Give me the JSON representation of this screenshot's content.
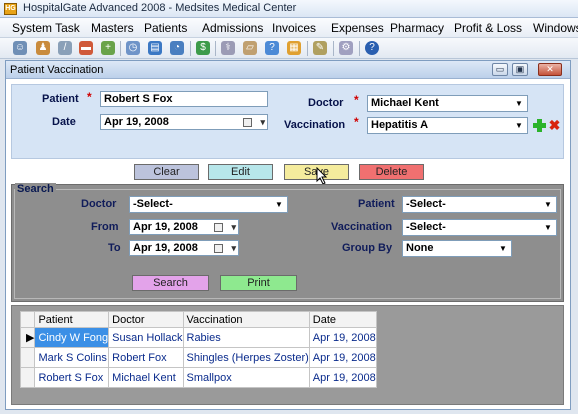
{
  "app": {
    "icon_text": "HG",
    "title": "HospitalGate Advanced 2008 - Medsites Medical Center"
  },
  "menu": [
    "System Task",
    "Masters",
    "Patients",
    "Admissions",
    "Invoices",
    "Expenses",
    "Pharmacy",
    "Profit & Loss",
    "Windows"
  ],
  "toolbar_icons": [
    "doctor-icon",
    "patient-icon",
    "syringe-icon",
    "ambulance-icon",
    "medical-kit-icon",
    "clock-icon",
    "folder-icon",
    "chart-icon",
    "dollar-icon",
    "medicine-icon",
    "bandage-icon",
    "question-icon",
    "report-icon",
    "edit-icon",
    "settings-icon",
    "help-icon"
  ],
  "window": {
    "title": "Patient Vaccination",
    "minimize_label": "▭",
    "restore_label": "▣",
    "close_label": "✕"
  },
  "form": {
    "patient_label": "Patient",
    "patient_value": "Robert S Fox",
    "date_label": "Date",
    "date_value": "Apr 19, 2008",
    "doctor_label": "Doctor",
    "doctor_value": "Michael Kent",
    "vaccination_label": "Vaccination",
    "vaccination_value": "Hepatitis A",
    "required_mark": "*"
  },
  "actions": {
    "clear": "Clear",
    "edit": "Edit",
    "save": "Save",
    "delete": "Delete"
  },
  "search": {
    "legend": "Search",
    "doctor_label": "Doctor",
    "doctor_value": "-Select-",
    "from_label": "From",
    "from_value": "Apr 19, 2008",
    "to_label": "To",
    "to_value": "Apr 19, 2008",
    "patient_label": "Patient",
    "patient_value": "-Select-",
    "vaccination_label": "Vaccination",
    "vaccination_value": "-Select-",
    "group_by_label": "Group By",
    "group_by_value": "None",
    "search_button": "Search",
    "print_button": "Print"
  },
  "grid": {
    "columns": [
      "Patient",
      "Doctor",
      "Vaccination",
      "Date"
    ],
    "current_row_marker": "▶",
    "rows": [
      [
        "Cindy W Fong",
        "Susan Hollack",
        "Rabies",
        "Apr 19, 2008"
      ],
      [
        "Mark S Colins",
        "Robert Fox",
        "Shingles (Herpes Zoster)",
        "Apr 19, 2008"
      ],
      [
        "Robert S Fox",
        "Michael Kent",
        "Smallpox",
        "Apr 19, 2008"
      ]
    ]
  },
  "colors": {
    "clear_button": "#bcc3dc",
    "edit_button": "#b7e6ea",
    "save_button": "#f5ec9d",
    "delete_button": "#f07070",
    "search_button": "#e3a3ea",
    "print_button": "#8ee98f",
    "selected_cell": "#3b8fe6"
  }
}
